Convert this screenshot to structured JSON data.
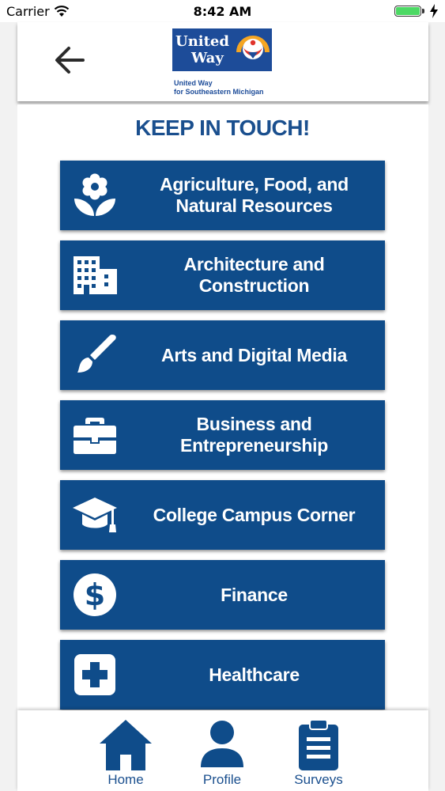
{
  "status_bar": {
    "carrier": "Carrier",
    "time": "8:42 AM",
    "battery_color": "#4cd964"
  },
  "header": {
    "back_icon": "arrow-left-icon",
    "logo": {
      "word1": "United",
      "word2": "Way",
      "subtitle_line1": "United Way",
      "subtitle_line2": "for Southeastern Michigan"
    }
  },
  "page_title": "KEEP IN TOUCH!",
  "categories": [
    {
      "label": "Agriculture, Food, and\nNatural Resources",
      "icon": "flower-icon"
    },
    {
      "label": "Architecture and\nConstruction",
      "icon": "building-icon"
    },
    {
      "label": "Arts and Digital Media",
      "icon": "paintbrush-icon"
    },
    {
      "label": "Business and\nEntrepreneurship",
      "icon": "briefcase-icon"
    },
    {
      "label": "College Campus Corner",
      "icon": "graduation-cap-icon"
    },
    {
      "label": "Finance",
      "icon": "dollar-icon"
    },
    {
      "label": "Healthcare",
      "icon": "medical-cross-icon"
    }
  ],
  "tabs": [
    {
      "label": "Home",
      "icon": "home-icon"
    },
    {
      "label": "Profile",
      "icon": "user-icon"
    },
    {
      "label": "Surveys",
      "icon": "clipboard-icon"
    }
  ],
  "colors": {
    "brand": "#0f4c8a",
    "title": "#1a4f8e",
    "logo_blue": "#1d4c99"
  }
}
